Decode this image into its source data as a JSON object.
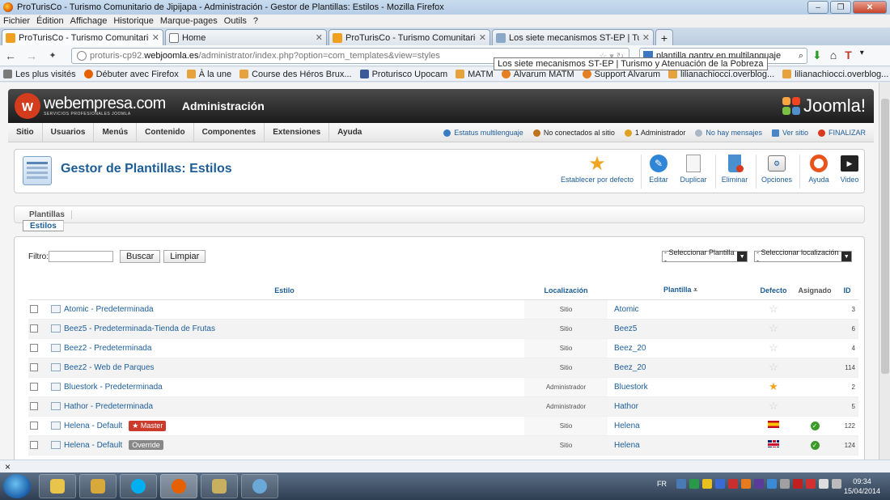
{
  "window": {
    "title": "ProTurisCo - Turismo Comunitario de Jipijapa - Administración - Gestor de Plantillas: Estilos - Mozilla Firefox"
  },
  "menubar": [
    "Fichier",
    "Édition",
    "Affichage",
    "Historique",
    "Marque-pages",
    "Outils",
    "?"
  ],
  "tabs": [
    {
      "label": "ProTurisCo - Turismo Comunitario d...",
      "icon": "joomla-icon",
      "active": true
    },
    {
      "label": "Home",
      "icon": "page-icon",
      "active": false
    },
    {
      "label": "ProTurisCo - Turismo Comunitario d...",
      "icon": "joomla-icon",
      "active": false
    },
    {
      "label": "Los siete mecanismos ST-EP | Turism...",
      "icon": "link-icon",
      "active": false
    }
  ],
  "nav": {
    "url_prefix": "proturis-cp92.",
    "url_domain": "webjoomla.es",
    "url_suffix": "/administrator/index.php?option=com_templates&view=styles",
    "search_value": "plantilla gantry en multilanguaje"
  },
  "tooltip": "Los siete mecanismos ST-EP | Turismo y Atenuación de la Pobreza",
  "bookmarks": [
    {
      "label": "Les plus visités",
      "icon": "bookmark-icon"
    },
    {
      "label": "Débuter avec Firefox",
      "icon": "firefox-icon"
    },
    {
      "label": "À la une",
      "icon": "rss-icon"
    },
    {
      "label": "Course des Héros Brux...",
      "icon": "rss-icon"
    },
    {
      "label": "Proturisco Upocam",
      "icon": "facebook-icon"
    },
    {
      "label": "MATM",
      "icon": "rss-icon"
    },
    {
      "label": "Alvarum MATM",
      "icon": "alvarum-icon"
    },
    {
      "label": "Support Alvarum",
      "icon": "alvarum-icon"
    },
    {
      "label": "lilianachiocci.overblog...",
      "icon": "rss-icon"
    },
    {
      "label": "lilianachiocci.overblog...",
      "icon": "rss-icon"
    }
  ],
  "header": {
    "logo_text": "webempresa.com",
    "logo_sub": "SERVICIOS PROFESIONALES JOOMLA",
    "admin_title": "Administración",
    "joomla_text": "Joomla!"
  },
  "jmenu": [
    "Sitio",
    "Usuarios",
    "Menús",
    "Contenido",
    "Componentes",
    "Extensiones",
    "Ayuda"
  ],
  "jstatus": [
    {
      "label": "Estatus multilenguaje",
      "icon": "globe-icon",
      "color": "#1f5d9a"
    },
    {
      "label": "No conectados al sitio",
      "icon": "users-icon",
      "color": "#333333"
    },
    {
      "label": "1 Administrador",
      "icon": "admin-icon",
      "color": "#333333"
    },
    {
      "label": "No hay mensajes",
      "icon": "message-icon",
      "color": "#1f5d9a"
    },
    {
      "label": "Ver sitio",
      "icon": "monitor-icon",
      "color": "#1f5d9a"
    },
    {
      "label": "FINALIZAR",
      "icon": "power-icon",
      "color": "#1f5d9a"
    }
  ],
  "page_title": "Gestor de Plantillas: Estilos",
  "toolbar": [
    {
      "label": "Establecer por defecto",
      "icon": "star-icon"
    },
    {
      "label": "Editar",
      "icon": "edit-icon"
    },
    {
      "label": "Duplicar",
      "icon": "copy-icon"
    },
    {
      "label": "Eliminar",
      "icon": "trash-icon"
    },
    {
      "label": "Opciones",
      "icon": "options-icon"
    },
    {
      "label": "Ayuda",
      "icon": "help-icon"
    },
    {
      "label": "Video",
      "icon": "video-icon"
    }
  ],
  "subtabs": [
    "Estilos",
    "Plantillas"
  ],
  "filter": {
    "label": "Filtro:",
    "value": "",
    "search_btn": "Buscar",
    "clear_btn": "Limpiar",
    "select_template": "- Seleccionar Plantilla -",
    "select_location": "- Seleccionar localización -"
  },
  "columns": {
    "style": "Estilo",
    "location": "Localización",
    "template": "Plantilla",
    "default": "Defecto",
    "assigned": "Asignado",
    "id": "ID"
  },
  "rows": [
    {
      "style": "Atomic - Predeterminada",
      "location": "Sitio",
      "template": "Atomic",
      "default": "star-off",
      "assigned": "",
      "id": "3",
      "badge": ""
    },
    {
      "style": "Beez5 - Predeterminada-Tienda de Frutas",
      "location": "Sitio",
      "template": "Beez5",
      "default": "star-off",
      "assigned": "",
      "id": "6",
      "badge": ""
    },
    {
      "style": "Beez2 - Predeterminada",
      "location": "Sitio",
      "template": "Beez_20",
      "default": "star-off",
      "assigned": "",
      "id": "4",
      "badge": ""
    },
    {
      "style": "Beez2 - Web de Parques",
      "location": "Sitio",
      "template": "Beez_20",
      "default": "star-off",
      "assigned": "",
      "id": "114",
      "badge": ""
    },
    {
      "style": "Bluestork - Predeterminada",
      "location": "Administrador",
      "template": "Bluestork",
      "default": "star-on",
      "assigned": "",
      "id": "2",
      "badge": ""
    },
    {
      "style": "Hathor - Predeterminada",
      "location": "Administrador",
      "template": "Hathor",
      "default": "star-off",
      "assigned": "",
      "id": "5",
      "badge": ""
    },
    {
      "style": "Helena - Default",
      "location": "Sitio",
      "template": "Helena",
      "default": "flag-es",
      "assigned": "check",
      "id": "122",
      "badge": "★ Master"
    },
    {
      "style": "Helena - Default",
      "location": "Sitio",
      "template": "Helena",
      "default": "flag-uk",
      "assigned": "check",
      "id": "124",
      "badge": "Override"
    }
  ],
  "taskbar": {
    "lang": "FR",
    "time": "09:34",
    "date": "15/04/2014"
  }
}
